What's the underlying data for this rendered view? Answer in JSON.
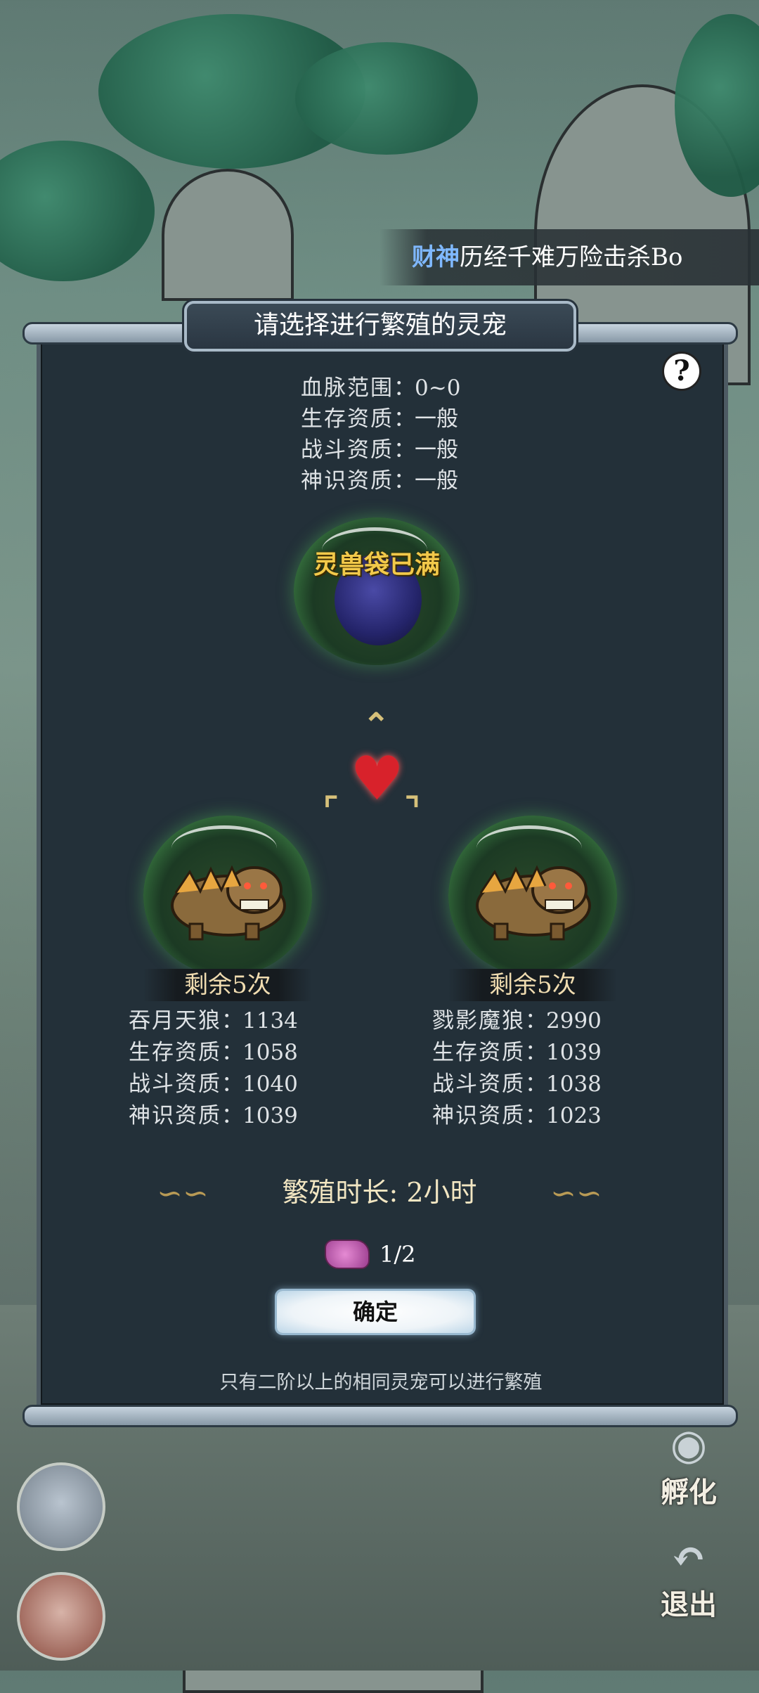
{
  "ticker": {
    "highlight": "财神",
    "text": "历经千难万险击杀Bo"
  },
  "panel": {
    "title": "请选择进行繁殖的灵宠",
    "help_symbol": "?",
    "requirements": [
      {
        "label": "血脉范围",
        "value": "0~0"
      },
      {
        "label": "生存资质",
        "value": "一般"
      },
      {
        "label": "战斗资质",
        "value": "一般"
      },
      {
        "label": "神识资质",
        "value": "一般"
      }
    ],
    "result_orb_text": "灵兽袋已满",
    "colon": "："
  },
  "pets": [
    {
      "remain": "剩余5次",
      "stats": [
        {
          "label": "吞月天狼",
          "value": "1134"
        },
        {
          "label": "生存资质",
          "value": "1058"
        },
        {
          "label": "战斗资质",
          "value": "1040"
        },
        {
          "label": "神识资质",
          "value": "1039"
        }
      ]
    },
    {
      "remain": "剩余5次",
      "stats": [
        {
          "label": "戮影魔狼",
          "value": "2990"
        },
        {
          "label": "生存资质",
          "value": "1039"
        },
        {
          "label": "战斗资质",
          "value": "1038"
        },
        {
          "label": "神识资质",
          "value": "1023"
        }
      ]
    }
  ],
  "duration": "繁殖时长: 2小时",
  "ticket": {
    "count": "1/2"
  },
  "confirm_label": "确定",
  "notice": "只有二阶以上的相同灵宠可以进行繁殖",
  "side_buttons": {
    "hatch": "孵化",
    "exit": "退出"
  },
  "colors": {
    "accent_gold": "#f2c94a",
    "panel_bg": "#233039",
    "heart": "#d8222b",
    "ticker_name": "#7fb8ff"
  }
}
